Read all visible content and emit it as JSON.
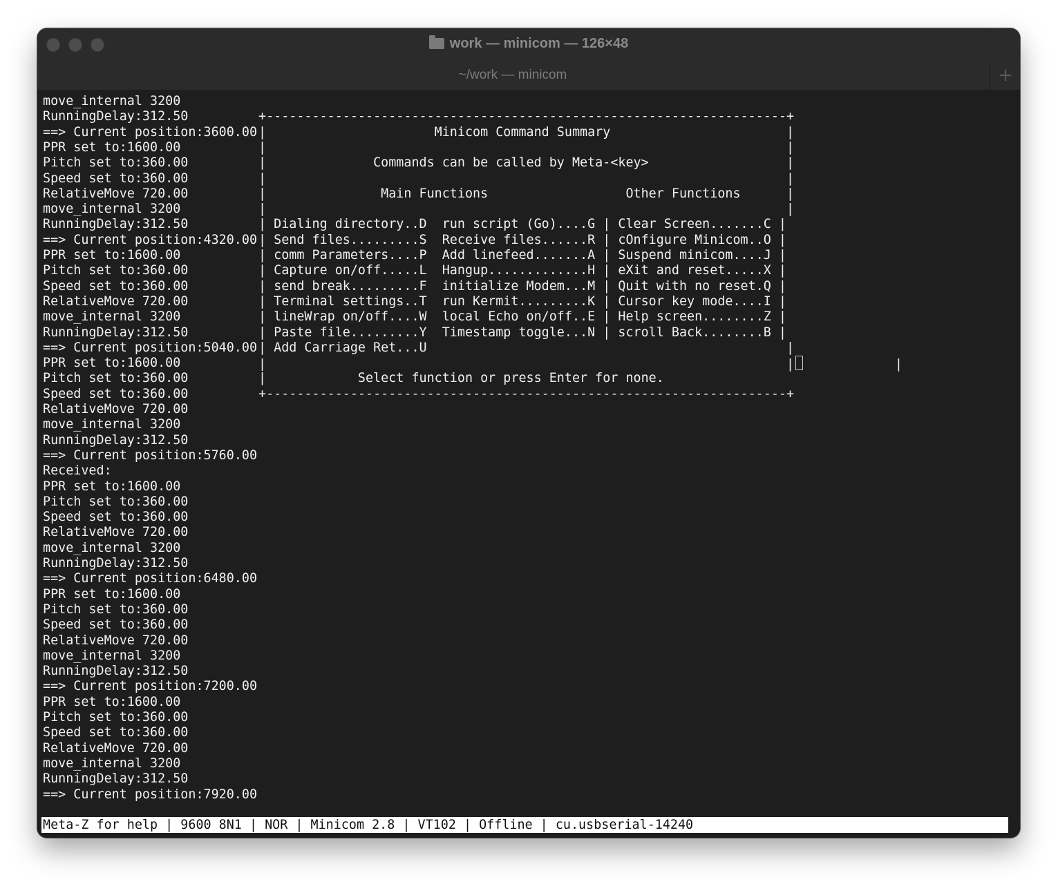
{
  "window": {
    "title": "work — minicom — 126×48",
    "tab_label": "~/work — minicom",
    "new_tab_label": "+"
  },
  "log_lines": [
    "move_internal 3200",
    "RunningDelay:312.50",
    "==> Current position:3600.00",
    "PPR set to:1600.00",
    "Pitch set to:360.00",
    "Speed set to:360.00",
    "RelativeMove 720.00",
    "move_internal 3200",
    "RunningDelay:312.50",
    "==> Current position:4320.00",
    "PPR set to:1600.00",
    "Pitch set to:360.00",
    "Speed set to:360.00",
    "RelativeMove 720.00",
    "move_internal 3200",
    "RunningDelay:312.50",
    "==> Current position:5040.00",
    "PPR set to:1600.00",
    "Pitch set to:360.00",
    "Speed set to:360.00",
    "RelativeMove 720.00",
    "move_internal 3200",
    "RunningDelay:312.50",
    "==> Current position:5760.00",
    "Received:",
    "PPR set to:1600.00",
    "Pitch set to:360.00",
    "Speed set to:360.00",
    "RelativeMove 720.00",
    "move_internal 3200",
    "RunningDelay:312.50",
    "==> Current position:6480.00",
    "PPR set to:1600.00",
    "Pitch set to:360.00",
    "Speed set to:360.00",
    "RelativeMove 720.00",
    "move_internal 3200",
    "RunningDelay:312.50",
    "==> Current position:7200.00",
    "PPR set to:1600.00",
    "Pitch set to:360.00",
    "Speed set to:360.00",
    "RelativeMove 720.00",
    "move_internal 3200",
    "RunningDelay:312.50",
    "==> Current position:7920.00"
  ],
  "summary_box": [
    "+--------------------------------------------------------------------+",
    "|                      Minicom Command Summary                       |",
    "|                                                                    |",
    "|              Commands can be called by Meta-<key>                  |",
    "|                                                                    |",
    "|               Main Functions                  Other Functions      |",
    "|                                                                    |",
    "| Dialing directory..D  run script (Go)....G | Clear Screen.......C |",
    "| Send files.........S  Receive files......R | cOnfigure Minicom..O |",
    "| comm Parameters....P  Add linefeed.......A | Suspend minicom....J |",
    "| Capture on/off.....L  Hangup.............H | eXit and reset.....X |",
    "| send break.........F  initialize Modem...M | Quit with no reset.Q |",
    "| Terminal settings..T  run Kermit.........K | Cursor key mode....I |",
    "| lineWrap on/off....W  local Echo on/off..E | Help screen........Z |",
    "| Paste file.........Y  Timestamp toggle...N | scroll Back........B |",
    "| Add Carriage Ret...U                                               |",
    "|                                                                    |",
    "|            Select function or press Enter for none.",
    "+--------------------------------------------------------------------+"
  ],
  "summary_prompt_tail": "            |",
  "status_bar": "Meta-Z for help | 9600 8N1 | NOR | Minicom 2.8 | VT102 | Offline | cu.usbserial-14240"
}
